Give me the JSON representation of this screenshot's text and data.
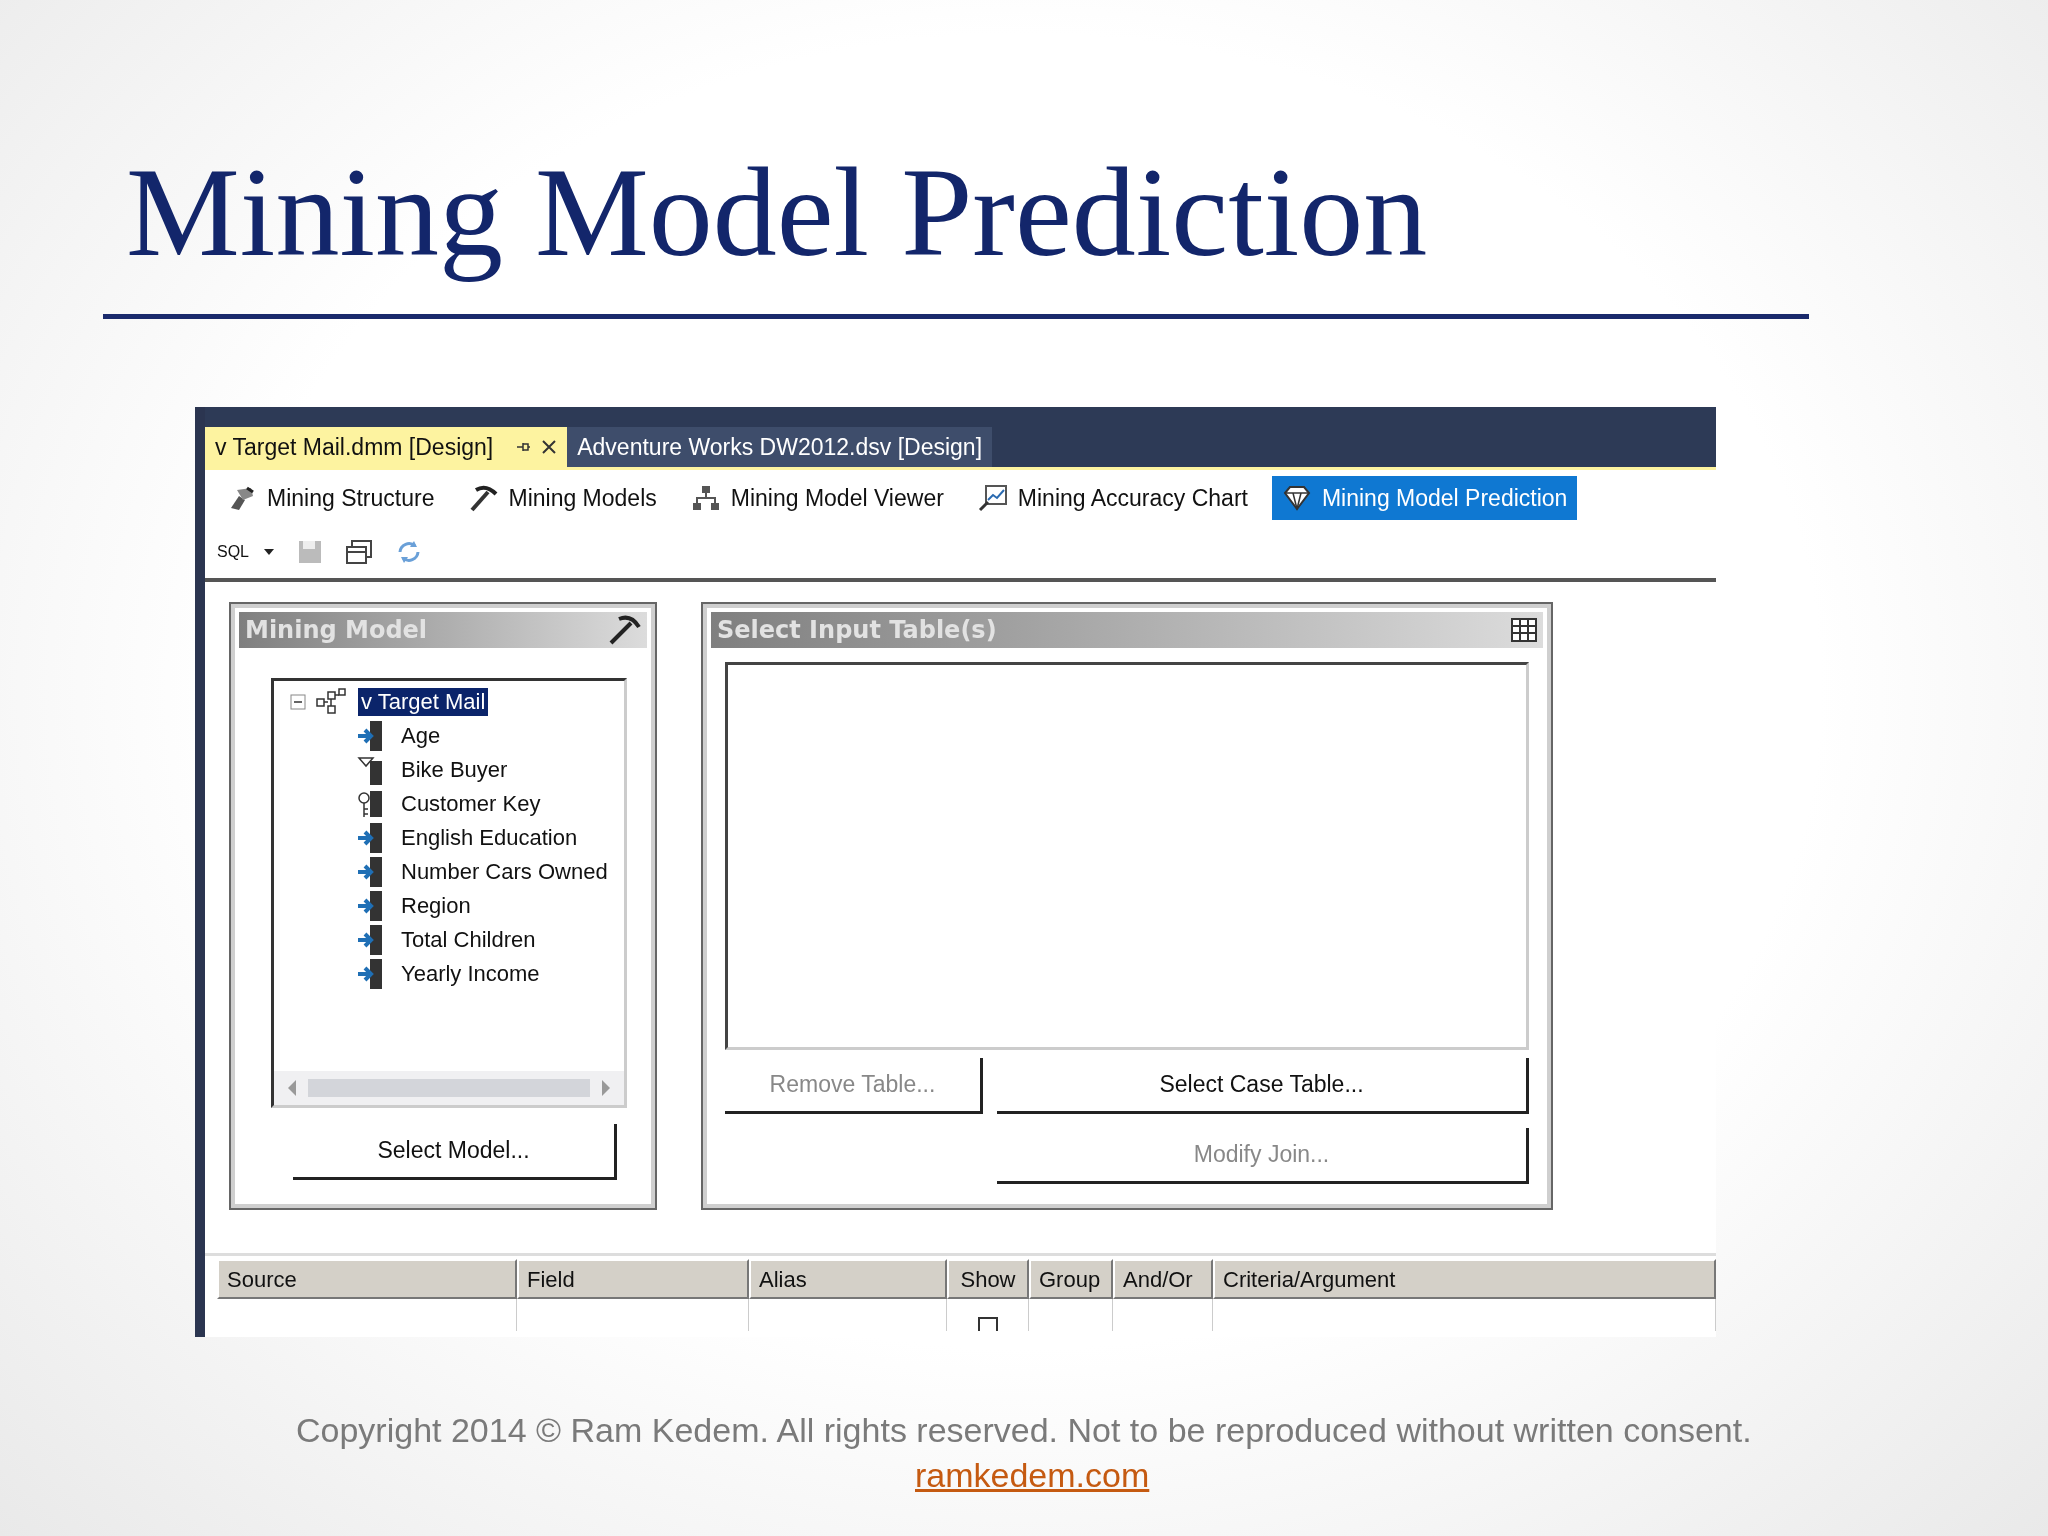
{
  "slide": {
    "title": "Mining Model Prediction",
    "footer": "Copyright 2014 © Ram Kedem. All rights reserved. Not to be reproduced without written consent.",
    "link": "ramkedem.com"
  },
  "document_tabs": [
    {
      "label": "v Target Mail.dmm [Design]",
      "selected": true
    },
    {
      "label": "Adventure Works DW2012.dsv [Design]",
      "selected": false
    }
  ],
  "designer_tabs": [
    {
      "label": "Mining Structure",
      "kind": "structure",
      "selected": false
    },
    {
      "label": "Mining Models",
      "kind": "models",
      "selected": false
    },
    {
      "label": "Mining Model Viewer",
      "kind": "viewer",
      "selected": false
    },
    {
      "label": "Mining Accuracy Chart",
      "kind": "chart",
      "selected": false
    },
    {
      "label": "Mining Model Prediction",
      "kind": "prediction",
      "selected": true
    }
  ],
  "toolbar": {
    "query_mode": "SQL"
  },
  "mining_model": {
    "title": "Mining Model",
    "tree": {
      "label": "v Target Mail",
      "expanded": true,
      "selected": true,
      "children": [
        {
          "label": "Age",
          "kind": "input",
          "selected": false
        },
        {
          "label": "Bike Buyer",
          "kind": "predict",
          "selected": false
        },
        {
          "label": "Customer Key",
          "kind": "key",
          "selected": false
        },
        {
          "label": "English Education",
          "kind": "input",
          "selected": false
        },
        {
          "label": "Number Cars Owned",
          "kind": "input",
          "selected": false
        },
        {
          "label": "Region",
          "kind": "input",
          "selected": false
        },
        {
          "label": "Total Children",
          "kind": "input",
          "selected": false
        },
        {
          "label": "Yearly Income",
          "kind": "input",
          "selected": false
        }
      ]
    },
    "button": "Select Model..."
  },
  "input_tables": {
    "title": "Select Input Table(s)",
    "buttons": [
      {
        "label": "Remove Table...",
        "disabled": true
      },
      {
        "label": "Select Case Table...",
        "disabled": false
      },
      {
        "label": "Modify Join...",
        "disabled": true
      }
    ]
  },
  "grid": {
    "columns": [
      "Source",
      "Field",
      "Alias",
      "Show",
      "Group",
      "And/Or",
      "Criteria/Argument"
    ],
    "rows": [
      {
        "show": false
      }
    ]
  }
}
